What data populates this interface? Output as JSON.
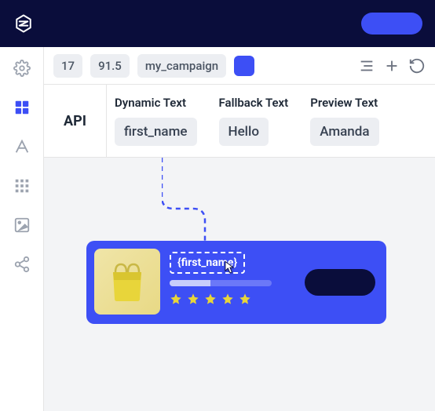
{
  "colors": {
    "accent": "#3d4ff5",
    "dark": "#0a0d3b",
    "star": "#e8d53a"
  },
  "toolbar": {
    "chips": [
      "17",
      "91.5",
      "my_campaign"
    ]
  },
  "api": {
    "label": "API",
    "columns": [
      {
        "header": "Dynamic Text",
        "value": "first_name"
      },
      {
        "header": "Fallback Text",
        "value": "Hello"
      },
      {
        "header": "Preview Text",
        "value": "Amanda"
      }
    ]
  },
  "card": {
    "placeholder": "{first_name}",
    "stars": 5
  }
}
